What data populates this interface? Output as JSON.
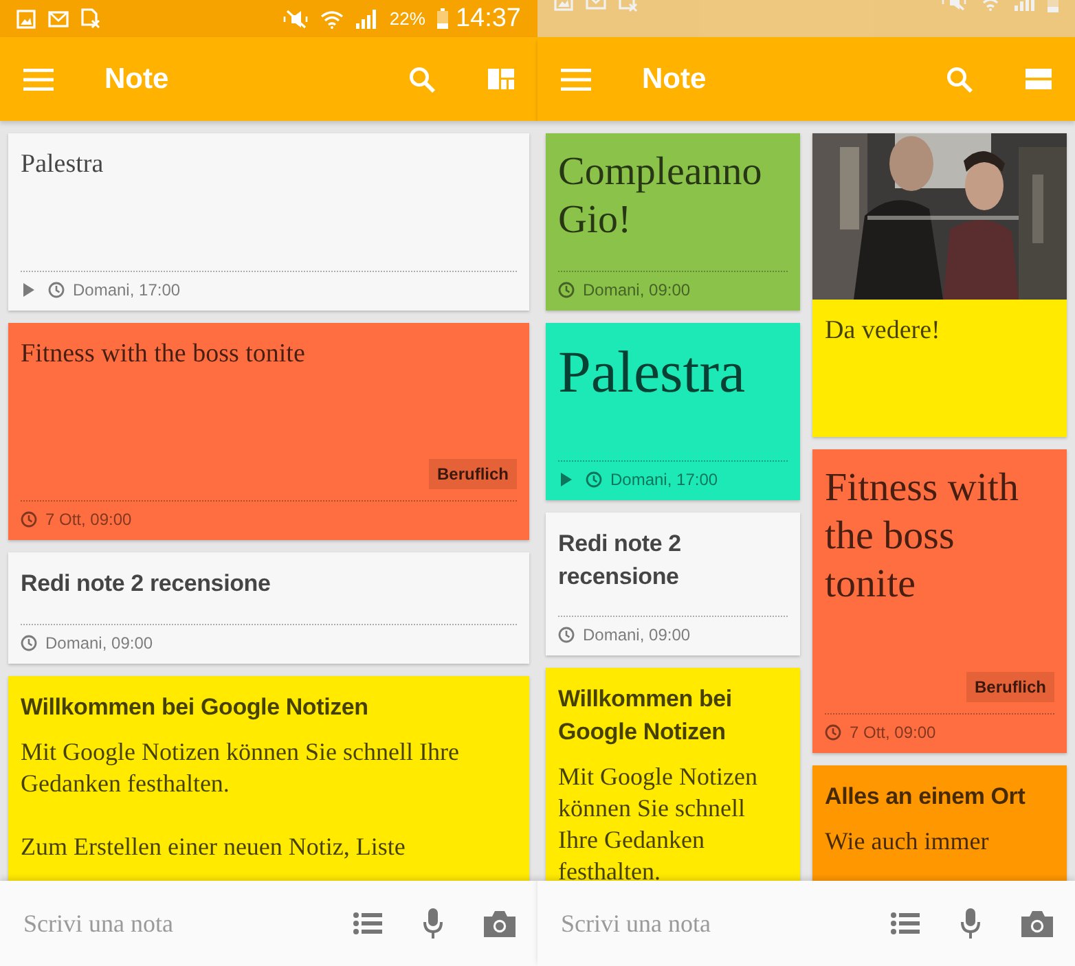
{
  "screens": [
    {
      "status_bar": {
        "dimmed": false,
        "battery": "22%",
        "time": "14:37"
      },
      "app_bar": {
        "title": "Note",
        "view_toggle": {
          "kind": "grid"
        }
      },
      "columns": [
        [
          {
            "kind": "plain",
            "title": "Palestra",
            "color": "#f7f7f7",
            "playable": true,
            "reminder": "Domani, 17:00"
          },
          {
            "kind": "plain",
            "title": "Fitness with the boss tonite",
            "color": "#ff6e40",
            "label": "Beruflich",
            "playable": false,
            "reminder": "7 Ott, 09:00"
          },
          {
            "kind": "heading",
            "title": "Redi note 2 recensione",
            "color": "#f7f7f7",
            "playable": false,
            "reminder": "Domani, 09:00"
          },
          {
            "kind": "heading",
            "title": "Willkommen bei Google Notizen",
            "color": "#ffea00",
            "body": [
              "Mit Google Notizen können Sie schnell Ihre Gedanken festhalten.",
              "Zum Erstellen einer neuen Notiz, Liste"
            ]
          }
        ]
      ],
      "composer": {
        "placeholder": "Scrivi una nota"
      }
    },
    {
      "status_bar": {
        "dimmed": true
      },
      "app_bar": {
        "title": "Note",
        "view_toggle": {
          "kind": "list"
        }
      },
      "columns": [
        [
          {
            "kind": "large",
            "title": "Compleanno Gio!",
            "color": "#8bc34a",
            "playable": false,
            "reminder": "Domani, 09:00"
          },
          {
            "kind": "huge",
            "title": "Palestra",
            "color": "#1de9b6",
            "playable": true,
            "reminder": "Domani, 17:00"
          },
          {
            "kind": "heading",
            "title": "Redi note 2 recensione",
            "color": "#f7f7f7",
            "playable": false,
            "reminder": "Domani, 09:00"
          },
          {
            "kind": "heading",
            "title": "Willkommen bei Google Notizen",
            "color": "#ffea00",
            "body": [
              "Mit Google Notizen können Sie schnell Ihre Gedanken festhalten."
            ]
          }
        ],
        [
          {
            "title": "Da vedere!",
            "color": "#ffea00"
          },
          {
            "kind": "large",
            "title": "Fitness with the boss tonite",
            "color": "#ff6e40",
            "label": "Beruflich",
            "playable": false,
            "reminder": "7 Ott, 09:00"
          },
          {
            "kind": "heading",
            "title": "Alles an einem Ort",
            "color": "#ff9800",
            "body": [
              "Wie auch immer"
            ]
          }
        ]
      ],
      "composer": {
        "placeholder": "Scrivi una nota"
      }
    }
  ]
}
